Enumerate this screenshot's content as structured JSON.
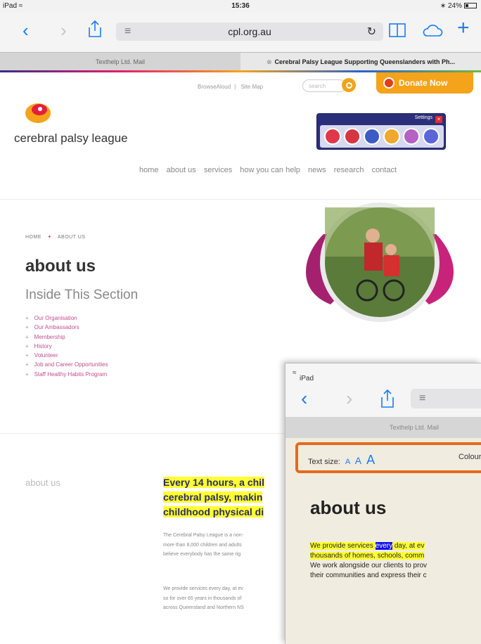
{
  "status": {
    "device": "iPad",
    "time": "15:36",
    "battery": "24%"
  },
  "browser": {
    "url": "cpl.org.au",
    "tabs": [
      {
        "label": "Texthelp Ltd. Mail"
      },
      {
        "label": "Cerebral Palsy League Supporting Queenslanders with Ph..."
      }
    ]
  },
  "site": {
    "top_links": [
      "BrowseAloud",
      "Site Map"
    ],
    "search_placeholder": "search",
    "donate_label": "Donate Now",
    "logo_text": "cerebral palsy league",
    "widget": {
      "settings_label": "Settings"
    },
    "nav": [
      "home",
      "about us",
      "services",
      "how you can help",
      "news",
      "research",
      "contact"
    ],
    "breadcrumb": [
      "HOME",
      "ABOUT US"
    ],
    "page_title": "about us",
    "section_title": "Inside This Section",
    "section_links": [
      "Our Organisation",
      "Our Ambassadors",
      "Membership",
      "History",
      "Volunteer",
      "Job and Career Opportunities",
      "Staff Healthy Habits Program"
    ],
    "content_label": "about us",
    "headline": [
      "Every 14 hours, a chil",
      "cerebral palsy, makin",
      "childhood physical di"
    ],
    "paragraph1": [
      "The Cerebral Palsy League is a non-",
      "more than 8,000 children and adults",
      "believe everybody has the same rig"
    ],
    "paragraph2": [
      "We provide services every day, at ev",
      "so for over 65 years in thousands of",
      "across Queensland and Northern NS"
    ]
  },
  "inset": {
    "device": "iPad",
    "tab_label": "Texthelp Ltd. Mail",
    "text_size_label": "Text size:",
    "size_options": [
      "A",
      "A",
      "A"
    ],
    "colour_label": "Colour",
    "heading": "about us",
    "line1_before": "We provide services ",
    "line1_word": "every",
    "line1_after": " day, at ev",
    "line2": "thousands of homes, schools, comm",
    "line3": "We work alongside our clients to prov",
    "line4": "their communities and express their c"
  }
}
